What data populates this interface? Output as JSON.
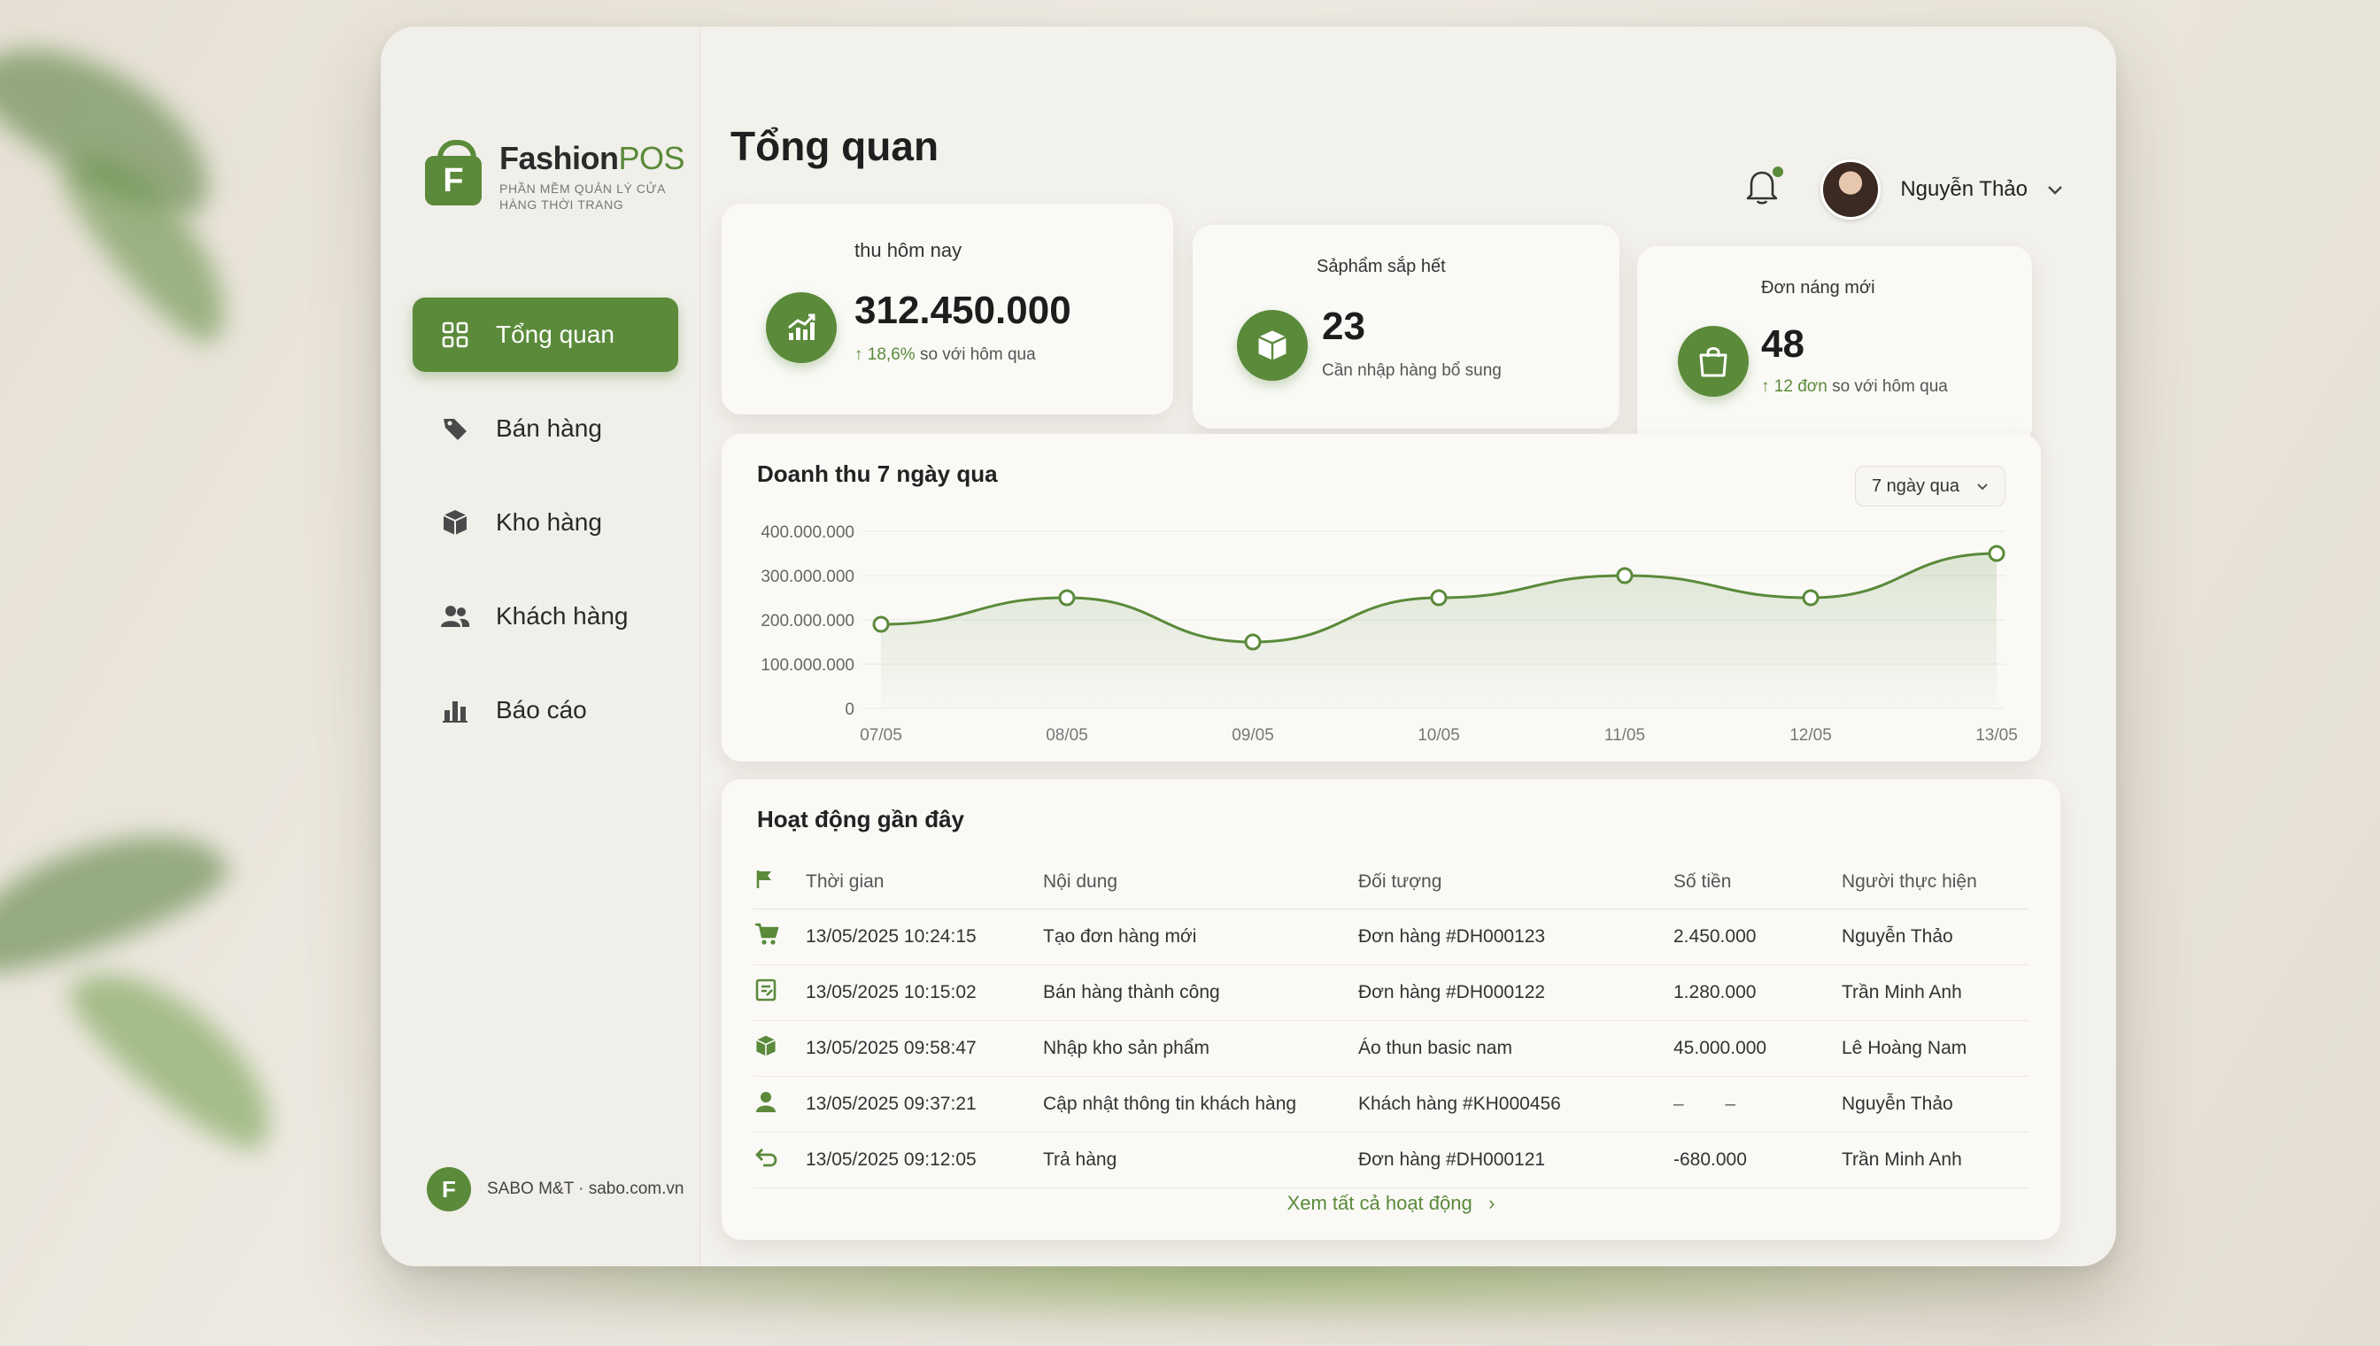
{
  "colors": {
    "accent": "#5a8a3a",
    "dot_red": "#e29a90",
    "dot_yellow": "#e8d27a",
    "dot_green": "#6aa84f"
  },
  "app": {
    "name_main": "Fashion",
    "name_accent": "POS",
    "subtitle": "PHẦN MỀM QUẢN LÝ CỬA HÀNG THỜI TRANG",
    "logo_letter": "F"
  },
  "nav": [
    {
      "label": "Tổng quan",
      "icon": "dashboard-grid-icon",
      "active": true
    },
    {
      "label": "Bán hàng",
      "icon": "price-tag-icon",
      "active": false
    },
    {
      "label": "Kho hàng",
      "icon": "box-icon",
      "active": false
    },
    {
      "label": "Khách hàng",
      "icon": "users-icon",
      "active": false
    },
    {
      "label": "Báo cáo",
      "icon": "bar-chart-icon",
      "active": false
    }
  ],
  "footer": {
    "badge": "F",
    "text": "SABO M&T · sabo.com.vn"
  },
  "header": {
    "title": "Tổng quan",
    "user_name": "Nguyễn Thảo"
  },
  "stats": [
    {
      "title": "thu hôm nay",
      "value": "312.450.000",
      "change": "18,6%",
      "note": "so với hôm qua",
      "icon": "trend-up-icon"
    },
    {
      "title": "Sảphẩm sắp hết",
      "value": "23",
      "note": "Cần nhập hàng bổ sung",
      "icon": "box-icon"
    },
    {
      "title": "Đơn náng mới",
      "value": "48",
      "change": "12 đơn",
      "note": "so với hôm qua",
      "icon": "shopping-bag-icon"
    }
  ],
  "revenue": {
    "title": "Doanh thu 7 ngày qua",
    "range_label": "7 ngày qua"
  },
  "chart_data": {
    "type": "area",
    "title": "Doanh thu 7 ngày qua",
    "categories": [
      "07/05",
      "08/05",
      "09/05",
      "10/05",
      "11/05",
      "12/05",
      "13/05"
    ],
    "values": [
      190000000,
      250000000,
      150000000,
      250000000,
      300000000,
      250000000,
      350000000
    ],
    "ylim": [
      0,
      400000000
    ],
    "yticks": [
      "400.000.000",
      "300.000.000",
      "200.000.000",
      "100.000.000",
      "0"
    ],
    "ytick_values": [
      400000000,
      300000000,
      200000000,
      100000000,
      0
    ],
    "grid": true
  },
  "activity": {
    "title": "Hoạt động gần đây",
    "columns": [
      "Thời gian",
      "Nội dung",
      "Đối tượng",
      "Số tiền",
      "Người thực hiện"
    ],
    "rows": [
      {
        "icon": "cart-icon",
        "time": "13/05/2025 10:24:15",
        "content": "Tạo đơn hàng mới",
        "target": "Đơn hàng #DH000123",
        "amount": "2.450.000",
        "user": "Nguyễn Thảo"
      },
      {
        "icon": "receipt-icon",
        "time": "13/05/2025 10:15:02",
        "content": "Bán hàng thành công",
        "target": "Đơn hàng #DH000122",
        "amount": "1.280.000",
        "user": "Trần Minh Anh"
      },
      {
        "icon": "box-icon",
        "time": "13/05/2025 09:58:47",
        "content": "Nhập kho sản phẩm",
        "target": "Áo thun basic nam",
        "amount": "45.000.000",
        "user": "Lê Hoàng Nam"
      },
      {
        "icon": "user-icon",
        "time": "13/05/2025 09:37:21",
        "content": "Cập nhật thông tin khách hàng",
        "target": "Khách hàng #KH000456",
        "amount": "–        –",
        "user": "Nguyễn Thảo"
      },
      {
        "icon": "return-icon",
        "time": "13/05/2025 09:12:05",
        "content": "Trả hàng",
        "target": "Đơn hàng #DH000121",
        "amount": "-680.000",
        "user": "Trần Minh Anh"
      }
    ],
    "view_all": "Xem tất cả hoạt động"
  }
}
